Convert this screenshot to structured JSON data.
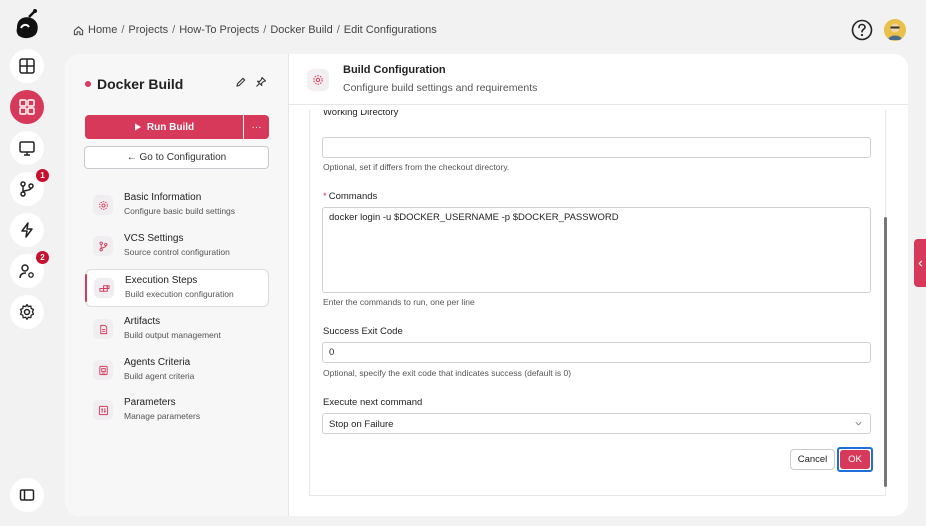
{
  "breadcrumb": {
    "items": [
      "Home",
      "Projects",
      "How-To Projects",
      "Docker Build",
      "Edit Configurations"
    ],
    "separator": "/"
  },
  "rail": {
    "badges": {
      "vcs": "1",
      "agents": "2"
    }
  },
  "project": {
    "title": "Docker Build",
    "run_label": "Run Build",
    "more_label": "···",
    "goto_label": "← Go to Configuration"
  },
  "nav": {
    "items": [
      {
        "title": "Basic Information",
        "subtitle": "Configure basic build settings",
        "icon": "gear-icon"
      },
      {
        "title": "VCS Settings",
        "subtitle": "Source control configuration",
        "icon": "branch-icon"
      },
      {
        "title": "Execution Steps",
        "subtitle": "Build execution configuration",
        "icon": "steps-icon"
      },
      {
        "title": "Artifacts",
        "subtitle": "Build output management",
        "icon": "artifact-icon"
      },
      {
        "title": "Agents Criteria",
        "subtitle": "Build agent criteria",
        "icon": "agent-icon"
      },
      {
        "title": "Parameters",
        "subtitle": "Manage parameters",
        "icon": "parameters-icon"
      }
    ],
    "active_index": 2
  },
  "content": {
    "title": "Build Configuration",
    "subtitle": "Configure build settings and requirements"
  },
  "form": {
    "working_dir_label": "Working Directory",
    "working_dir_value": "",
    "working_dir_hint": "Optional, set if differs from the checkout directory.",
    "commands_label": "Commands",
    "commands_required": "*",
    "commands_value": "docker login -u $DOCKER_USERNAME -p $DOCKER_PASSWORD",
    "commands_hint": "Enter the commands to run, one per line",
    "exit_code_label": "Success Exit Code",
    "exit_code_value": "0",
    "exit_code_hint": "Optional, specify the exit code that indicates success (default is 0)",
    "next_cmd_label": "Execute next command",
    "next_cmd_value": "Stop on Failure",
    "cancel_label": "Cancel",
    "ok_label": "OK"
  },
  "colors": {
    "accent": "#d6395a",
    "focus": "#1e6fd9"
  }
}
